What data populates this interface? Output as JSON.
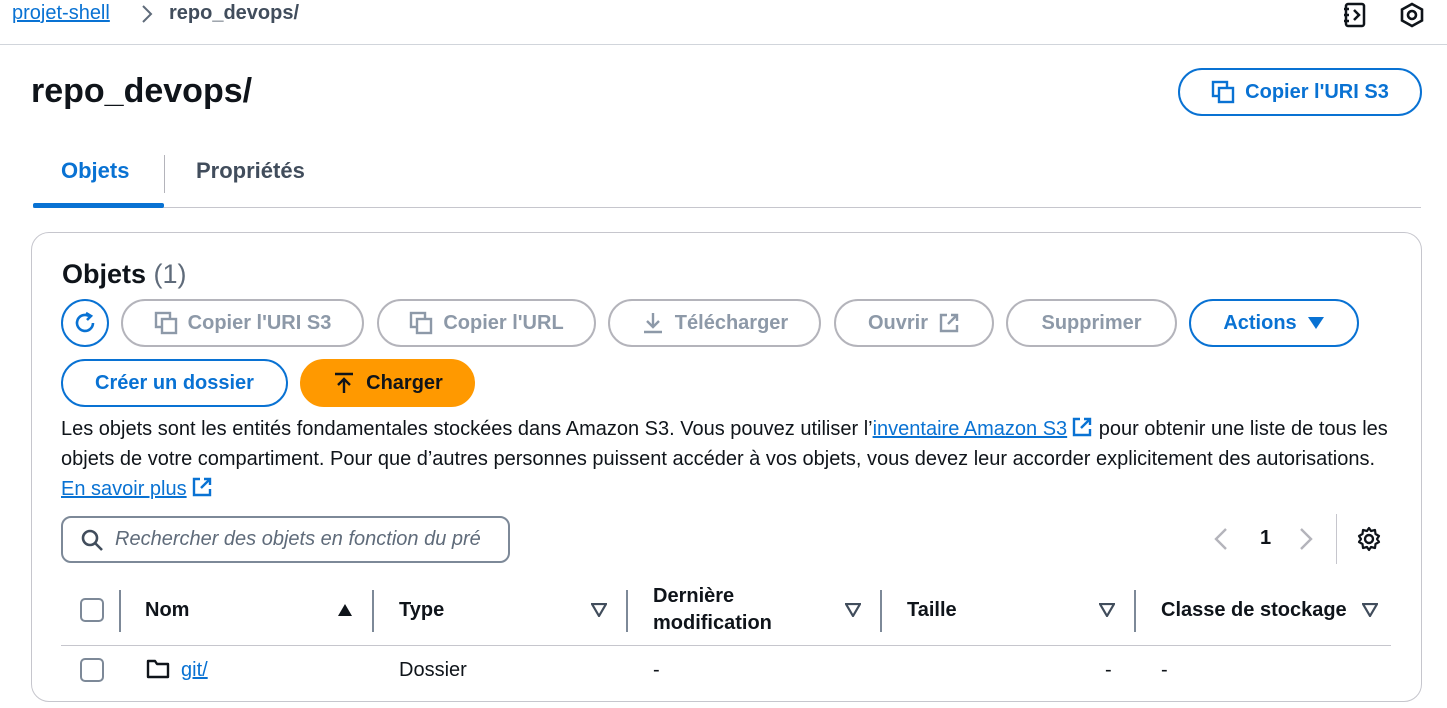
{
  "breadcrumb": {
    "parent": "projet-shell",
    "current": "repo_devops/"
  },
  "page_title": "repo_devops/",
  "header_button": "Copier l'URI S3",
  "tabs": [
    {
      "label": "Objets",
      "active": true
    },
    {
      "label": "Propriétés",
      "active": false
    }
  ],
  "panel": {
    "title": "Objets",
    "count": "(1)",
    "toolbar": {
      "copy_uri": "Copier l'URI S3",
      "copy_url": "Copier l'URL",
      "download": "Télécharger",
      "open": "Ouvrir",
      "delete": "Supprimer",
      "actions": "Actions",
      "create_folder": "Créer un dossier",
      "upload": "Charger"
    },
    "description": {
      "part1": "Les objets sont les entités fondamentales stockées dans Amazon S3. Vous pouvez utiliser l’",
      "link1": "inventaire Amazon S3",
      "part2": " pour obtenir une liste de tous les objets de votre compartiment. Pour que d’autres personnes puissent accéder à vos objets, vous devez leur accorder explicitement des autorisations. ",
      "link2": "En savoir plus"
    },
    "search": {
      "placeholder": "Rechercher des objets en fonction du pré"
    },
    "pagination": {
      "page": "1"
    },
    "columns": [
      "Nom",
      "Type",
      "Dernière",
      "modification",
      "Taille",
      "Classe de stockage"
    ],
    "rows": [
      {
        "name": "git/",
        "type": "Dossier",
        "modified": "-",
        "size": "-",
        "storage_class": "-"
      }
    ]
  },
  "colors": {
    "accent": "#0972d3",
    "primary": "#ff9900",
    "disabled": "#8d99a8"
  }
}
